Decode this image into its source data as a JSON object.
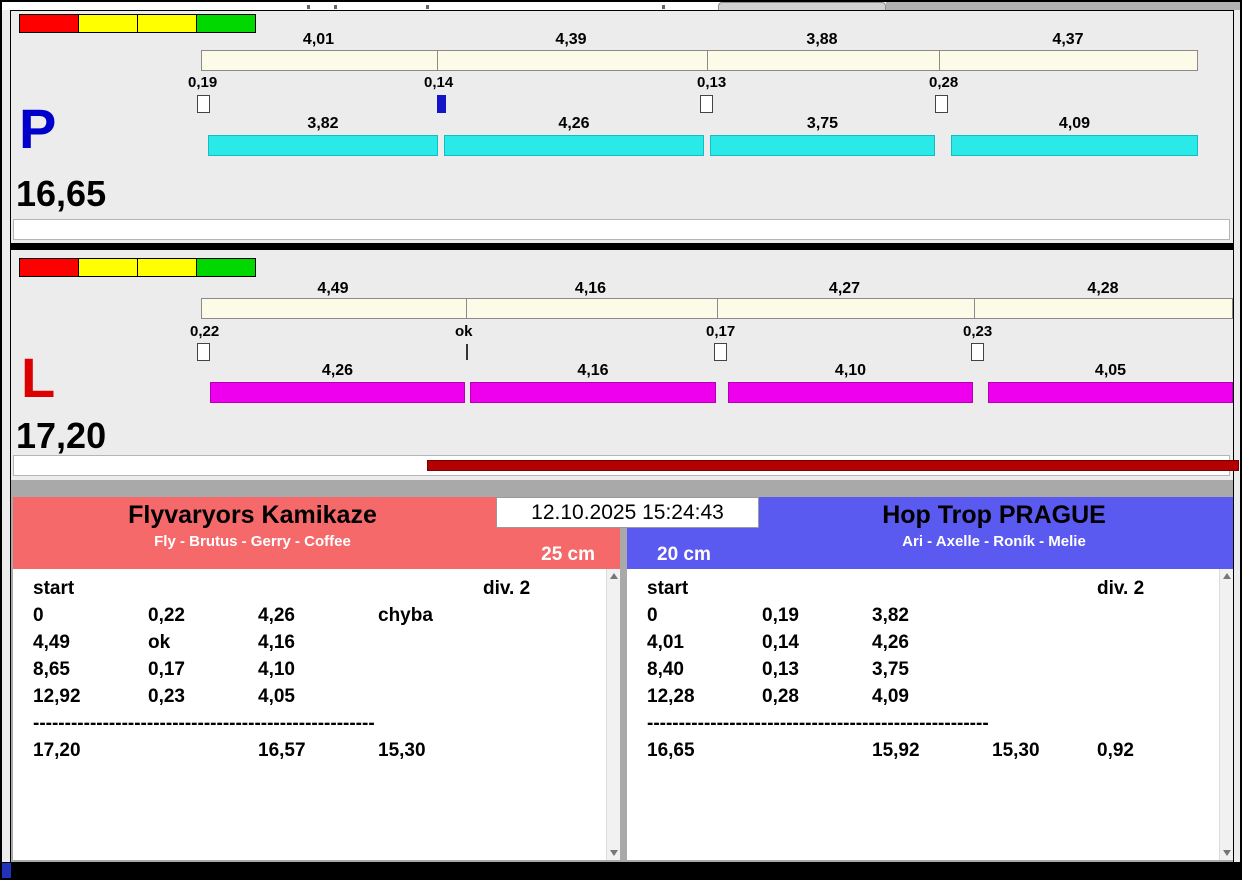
{
  "window": {
    "datetime": "12.10.2025 15:24:43"
  },
  "start_lights": [
    "red",
    "yellow",
    "yellow",
    "green"
  ],
  "lanes": [
    {
      "letter": "P",
      "total": "16,65",
      "splits": [
        "4,01",
        "4,39",
        "3,88",
        "4,37"
      ],
      "reactions": [
        "0,19",
        "0,14",
        "0,13",
        "0,28"
      ],
      "dog_times": [
        "3,82",
        "4,26",
        "3,75",
        "4,09"
      ]
    },
    {
      "letter": "L",
      "total": "17,20",
      "splits": [
        "4,49",
        "4,16",
        "4,27",
        "4,28"
      ],
      "reactions": [
        "0,22",
        "ok",
        "0,17",
        "0,23"
      ],
      "dog_times": [
        "4,26",
        "4,16",
        "4,10",
        "4,05"
      ]
    }
  ],
  "teams": [
    {
      "name": "Flyvaryors Kamikaze",
      "lineup": "Fly - Brutus - Gerry - Coffee",
      "jump_height": "25 cm",
      "table": {
        "start_label": "start",
        "division": "div. 2",
        "rows": [
          [
            "0",
            "0,22",
            "4,26",
            "chyba",
            ""
          ],
          [
            "4,49",
            "ok",
            "4,16",
            "",
            ""
          ],
          [
            "8,65",
            "0,17",
            "4,10",
            "",
            ""
          ],
          [
            "12,92",
            "0,23",
            "4,05",
            "",
            ""
          ]
        ],
        "separator": "------------------------------------------------------",
        "totals": [
          "17,20",
          "",
          "16,57",
          "15,30",
          ""
        ]
      }
    },
    {
      "name": "Hop Trop PRAGUE",
      "lineup": "Ari - Axelle - Roník - Melie",
      "jump_height": "20 cm",
      "table": {
        "start_label": "start",
        "division": "div. 2",
        "rows": [
          [
            "0",
            "0,19",
            "3,82",
            "",
            ""
          ],
          [
            "4,01",
            "0,14",
            "4,26",
            "",
            ""
          ],
          [
            "8,40",
            "0,13",
            "3,75",
            "",
            ""
          ],
          [
            "12,28",
            "0,28",
            "4,09",
            "",
            ""
          ]
        ],
        "separator": "------------------------------------------------------",
        "totals": [
          "16,65",
          "",
          "15,92",
          "15,30",
          "0,92"
        ]
      }
    }
  ],
  "colors": {
    "lane_p_bar": "#2ae9e9",
    "lane_l_bar": "#ee00ee",
    "lane_p_letter": "#0000cc",
    "lane_l_letter": "#dd0000",
    "split_track": "#fbfbe8",
    "team_left_header": "#f5696a",
    "team_right_header": "#5a5af0",
    "progress_bar": "#b30000",
    "light_red": "#ff0000",
    "light_yellow": "#ffff00",
    "light_green": "#00d800"
  }
}
